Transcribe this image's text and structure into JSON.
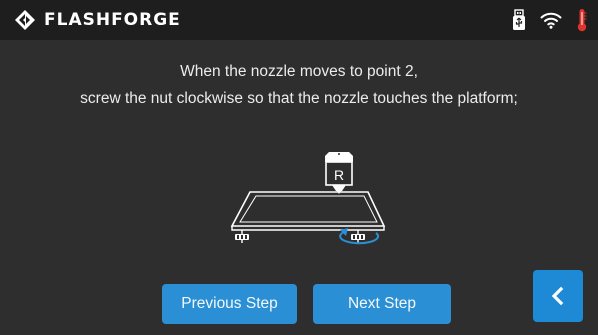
{
  "app": {
    "brand": "FLASHFORGE"
  },
  "status": {
    "icons": [
      "usb-icon",
      "wifi-icon",
      "thermometer-icon"
    ],
    "usb_color": "#ffffff",
    "wifi_color": "#ffffff",
    "thermometer_color": "#e0322f"
  },
  "instruction": {
    "line1": "When the nozzle moves to point 2,",
    "line2": "screw the nut clockwise so that the nozzle touches the platform;"
  },
  "illustration": {
    "nozzle_label": "R"
  },
  "buttons": {
    "previous_label": "Previous Step",
    "next_label": "Next Step",
    "back_icon": "chevron-left-icon"
  },
  "colors": {
    "background": "#2e2e2e",
    "topbar": "#1e1e1e",
    "button": "#2a8fd4",
    "accent_arrow": "#2a8fd4"
  }
}
